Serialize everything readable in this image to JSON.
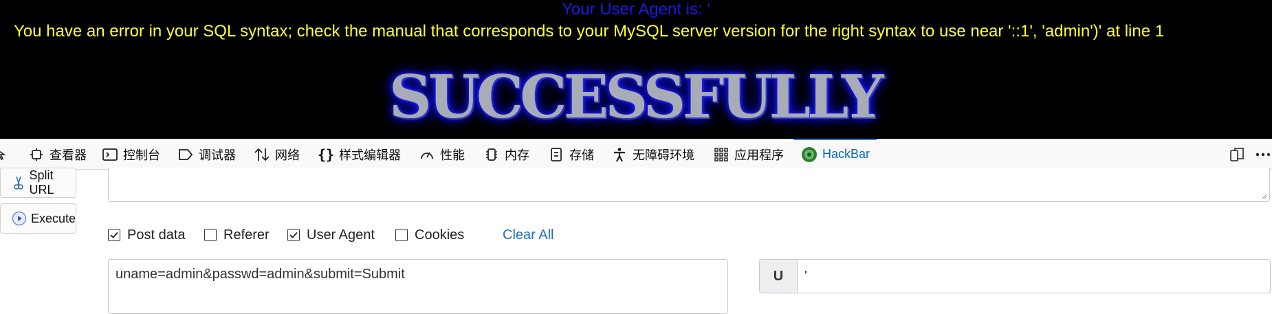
{
  "page": {
    "ua_message": "Your User Agent is: '",
    "sql_error": "You have an error in your SQL syntax; check the manual that corresponds to your MySQL server version for the right syntax to use near '::1', 'admin')' at line 1",
    "banner": "SUCCESSFULLY"
  },
  "devtools": {
    "tabs": [
      {
        "label": "查看器",
        "icon": "inspector-icon"
      },
      {
        "label": "控制台",
        "icon": "console-icon"
      },
      {
        "label": "调试器",
        "icon": "debugger-icon"
      },
      {
        "label": "网络",
        "icon": "network-icon"
      },
      {
        "label": "样式编辑器",
        "icon": "style-editor-icon"
      },
      {
        "label": "性能",
        "icon": "performance-icon"
      },
      {
        "label": "内存",
        "icon": "memory-icon"
      },
      {
        "label": "存储",
        "icon": "storage-icon"
      },
      {
        "label": "无障碍环境",
        "icon": "accessibility-icon"
      },
      {
        "label": "应用程序",
        "icon": "application-icon"
      },
      {
        "label": "HackBar",
        "icon": "hackbar-icon",
        "active": true
      }
    ]
  },
  "hackbar": {
    "split_url": "Split URL",
    "execute": "Execute",
    "options": {
      "post_data": {
        "label": "Post data",
        "checked": true
      },
      "referer": {
        "label": "Referer",
        "checked": false
      },
      "user_agent": {
        "label": "User Agent",
        "checked": true
      },
      "cookies": {
        "label": "Cookies",
        "checked": false
      }
    },
    "clear_all": "Clear All",
    "post_body": "uname=admin&passwd=admin&submit=Submit",
    "ua_prefix": "U",
    "ua_value": "'"
  },
  "colors": {
    "ua_text": "#1a1ae6",
    "error_text": "#ffff33",
    "accent": "#0a84ff",
    "link": "#1b6fc4"
  }
}
